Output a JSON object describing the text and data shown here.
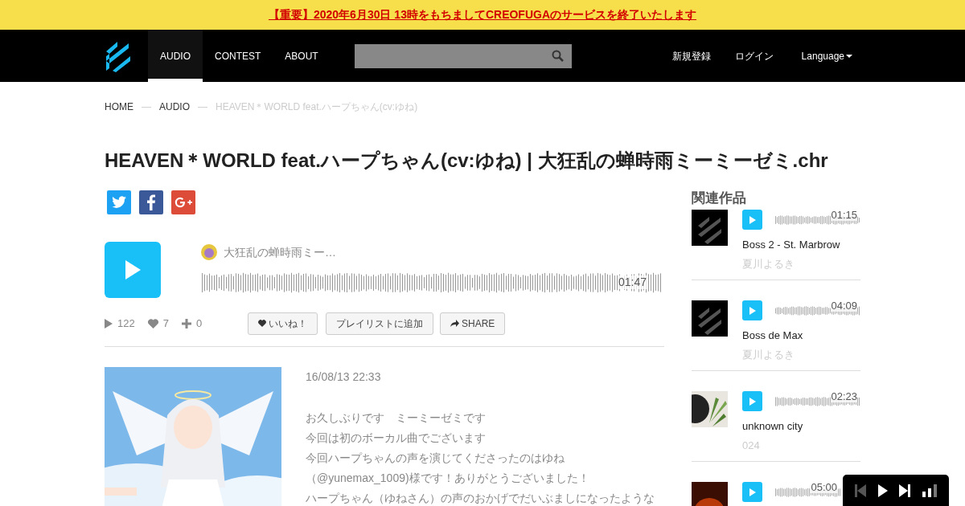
{
  "notice": {
    "text": "【重要】2020年6月30日 13時をもちましてCREOFUGAのサービスを終了いたします"
  },
  "navbar": {
    "items": [
      {
        "label": "AUDIO",
        "selected": true
      },
      {
        "label": "CONTEST",
        "selected": false
      },
      {
        "label": "ABOUT",
        "selected": false
      }
    ],
    "right_links": [
      "新規登録",
      "ログイン"
    ],
    "language": "Language"
  },
  "breadcrumb": {
    "items": [
      {
        "label": "HOME",
        "kind": "link"
      },
      {
        "label": "AUDIO",
        "kind": "link"
      },
      {
        "label": "HEAVEN＊WORLD feat.ハープちゃん(cv:ゆね)",
        "kind": "current"
      }
    ],
    "separators": [
      "—",
      "—"
    ]
  },
  "title": "HEAVEN＊WORLD feat.ハープちゃん(cv:ゆね) | 大狂乱の蝉時雨ミーミーゼミ.chr",
  "share": [
    {
      "kind": "twitter"
    },
    {
      "kind": "facebook"
    },
    {
      "kind": "googleplus"
    }
  ],
  "player": {
    "artist": "大狂乱の蝉時雨ミー…",
    "duration": "01:47"
  },
  "stats": {
    "plays": "122",
    "likes": "7",
    "adds": "0"
  },
  "actions": [
    {
      "kind": "like",
      "label": "いいね！"
    },
    {
      "kind": "playlist",
      "label": "プレイリストに追加"
    },
    {
      "kind": "share",
      "label": "SHARE"
    }
  ],
  "post": {
    "date": "16/08/13 22:33",
    "lines": [
      "お久しぶりです　ミーミーゼミです",
      "今回は初のボーカル曲でございます",
      "今回ハープちゃんの声を演じてくださったのはゆね",
      "（@yunemax_1009)様です！ありがとうございました！",
      "ハープちゃん（ゆねさん）の声のおかげでだいぶましになったような"
    ]
  },
  "related": {
    "heading": "関連作品",
    "items": [
      {
        "kind": "logo",
        "duration": "01:15",
        "title": "Boss 2 - St. Marbrow",
        "author": "夏川よるき"
      },
      {
        "kind": "logo",
        "duration": "04:09",
        "title": "Boss de Max",
        "author": "夏川よるき"
      },
      {
        "kind": "picture",
        "duration": "02:23",
        "title": "unknown city",
        "author": "024"
      },
      {
        "kind": "picture",
        "duration": "05:00"
      }
    ]
  }
}
